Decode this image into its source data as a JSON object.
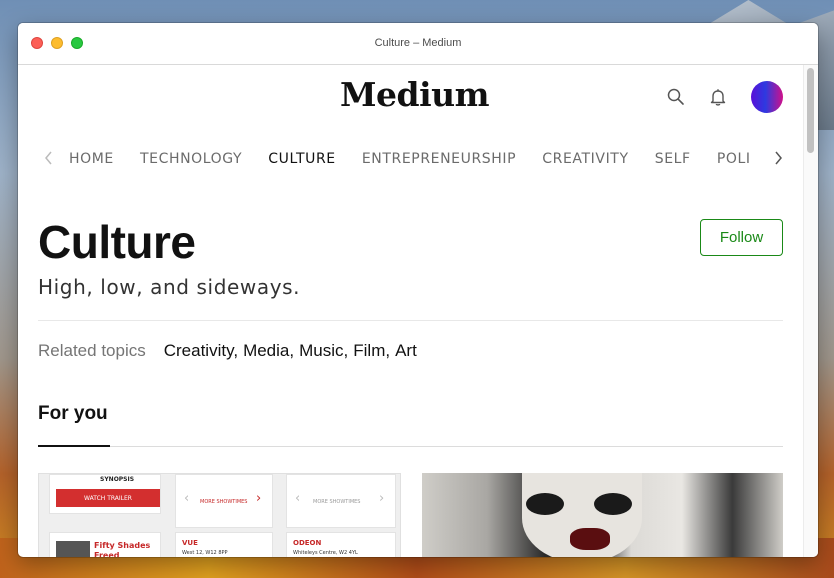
{
  "window": {
    "title": "Culture – Medium"
  },
  "header": {
    "logo": "Medium",
    "icons": [
      "search-icon",
      "bell-icon"
    ],
    "avatar_colors": [
      "#5a10d8",
      "#2d3ae0",
      "#d0108a"
    ]
  },
  "nav": {
    "items": [
      {
        "label": "HOME"
      },
      {
        "label": "TECHNOLOGY"
      },
      {
        "label": "CULTURE",
        "active": true
      },
      {
        "label": "ENTREPRENEURSHIP"
      },
      {
        "label": "CREATIVITY"
      },
      {
        "label": "SELF"
      },
      {
        "label": "POLI"
      }
    ]
  },
  "topic": {
    "title": "Culture",
    "subtitle": "High, low, and sideways.",
    "follow_label": "Follow"
  },
  "related": {
    "label": "Related topics",
    "topics": [
      "Creativity",
      "Media",
      "Music",
      "Film",
      "Art"
    ]
  },
  "section": {
    "title": "For you"
  },
  "card1": {
    "synopsis": "SYNOPSIS",
    "trailer": "WATCH TRAILER",
    "more_showtimes": "MORE SHOWTIMES",
    "movie": "Fifty Shades Freed",
    "cinema1": {
      "name": "VUE",
      "address": "West 12, W12 8PP"
    },
    "cinema2": {
      "name": "ODEON",
      "address": "Whiteleys Centre, W2 4YL"
    }
  },
  "colors": {
    "accent_green": "#1a8917",
    "text_primary": "#111111",
    "text_muted": "#757575"
  }
}
